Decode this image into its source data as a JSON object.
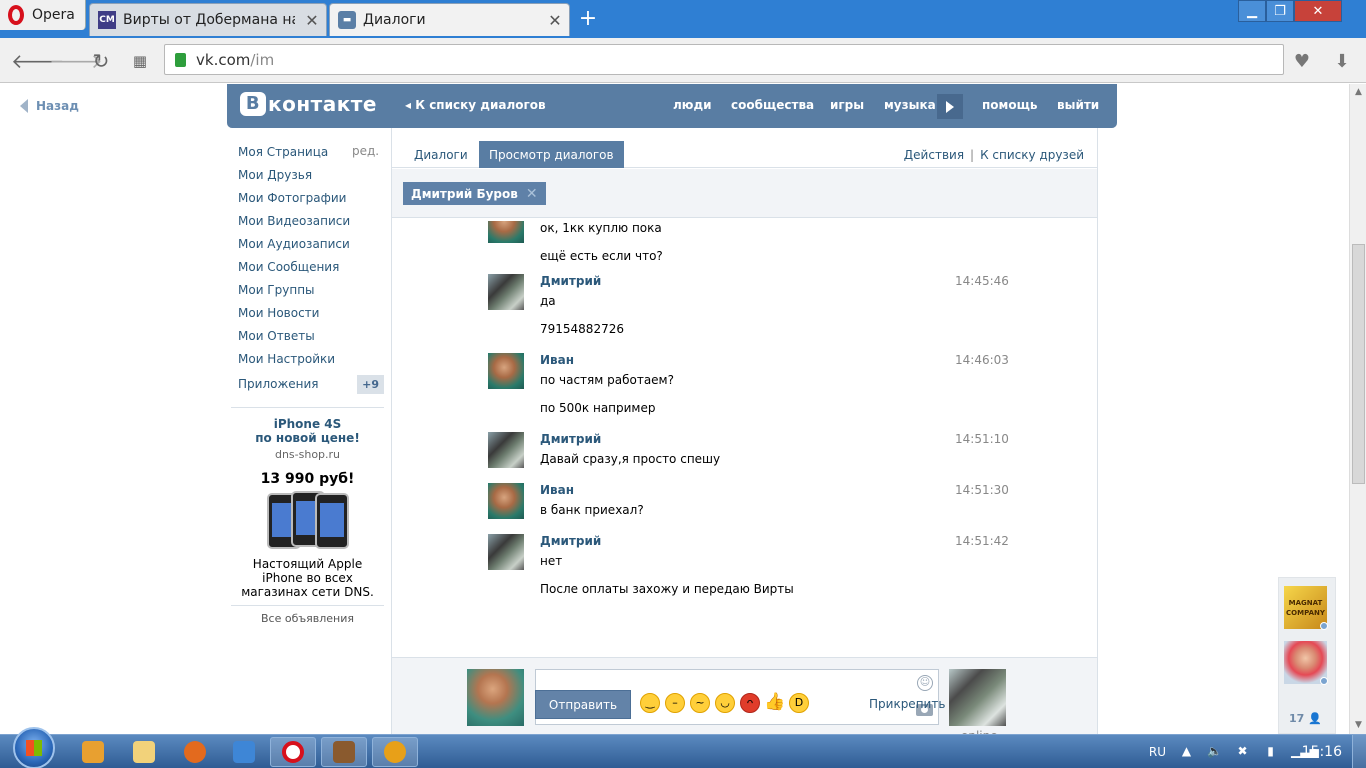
{
  "browser": {
    "menu_label": "Opera",
    "tabs": [
      {
        "icon": "cm-favicon",
        "icon_text": "CM",
        "title": "Вирты от Добермана на г"
      },
      {
        "icon": "vk-messages-favicon",
        "title": "Диалоги"
      }
    ],
    "new_tab": "+",
    "url_host": "vk.com",
    "url_path": "/im"
  },
  "page": {
    "back_link": "Назад",
    "header": {
      "logo": "контакте",
      "logo_letter": "В",
      "back_to_list": "К списку диалогов",
      "nav": [
        "люди",
        "сообщества",
        "игры",
        "музыка",
        "помощь",
        "выйти"
      ]
    },
    "left_menu": {
      "edit": "ред.",
      "items": [
        "Моя Страница",
        "Мои Друзья",
        "Мои Фотографии",
        "Мои Видеозаписи",
        "Мои Аудиозаписи",
        "Мои Сообщения",
        "Мои Группы",
        "Мои Новости",
        "Мои Ответы",
        "Мои Настройки"
      ],
      "apps_label": "Приложения",
      "apps_badge": "+9"
    },
    "ad": {
      "title_line1": "iPhone 4S",
      "title_line2": "по новой цене!",
      "domain": "dns-shop.ru",
      "price": "13 990 руб!",
      "text_line1": "Настоящий Apple",
      "text_line2": "iPhone во всех",
      "text_line3": "магазинах сети DNS.",
      "all_ads": "Все объявления"
    },
    "im": {
      "tabs": [
        "Диалоги",
        "Просмотр диалогов"
      ],
      "actions": "Действия",
      "separator": "|",
      "friends_list": "К списку друзей",
      "peer_chip": "Дмитрий Буров",
      "messages": [
        {
          "author": "",
          "time": "",
          "avatar": "ivan",
          "lines": [
            "ок, 1кк куплю пока",
            "ещё есть если что?"
          ]
        },
        {
          "author": "Дмитрий",
          "time": "14:45:46",
          "avatar": "dima",
          "lines": [
            "да",
            "79154882726"
          ]
        },
        {
          "author": "Иван",
          "time": "14:46:03",
          "avatar": "ivan",
          "lines": [
            "по частям работаем?",
            "по 500к например"
          ]
        },
        {
          "author": "Дмитрий",
          "time": "14:51:10",
          "avatar": "dima",
          "lines": [
            "Давай сразу,я просто спешу"
          ]
        },
        {
          "author": "Иван",
          "time": "14:51:30",
          "avatar": "ivan",
          "lines": [
            "в банк приехал?"
          ]
        },
        {
          "author": "Дмитрий",
          "time": "14:51:42",
          "avatar": "dima",
          "lines": [
            "нет",
            "После оплаты захожу и передаю Вирты"
          ]
        }
      ],
      "composer": {
        "input_value": "",
        "send_label": "Отправить",
        "attach_label": "Прикрепить",
        "peer_status": "online",
        "emoji": [
          "smile",
          "confused",
          "unamused",
          "relieved",
          "angry",
          "thumbs-up",
          "laughing"
        ]
      }
    },
    "side_widget": {
      "app_label": "MAGNAT COMPANY",
      "online_count": "17"
    }
  },
  "taskbar": {
    "lang": "RU",
    "time": "15:16"
  },
  "colors": {
    "vk_blue": "#597da3",
    "link": "#2b587a",
    "opera_red": "#d7101c",
    "tab_strip": "#2f7fd3"
  }
}
